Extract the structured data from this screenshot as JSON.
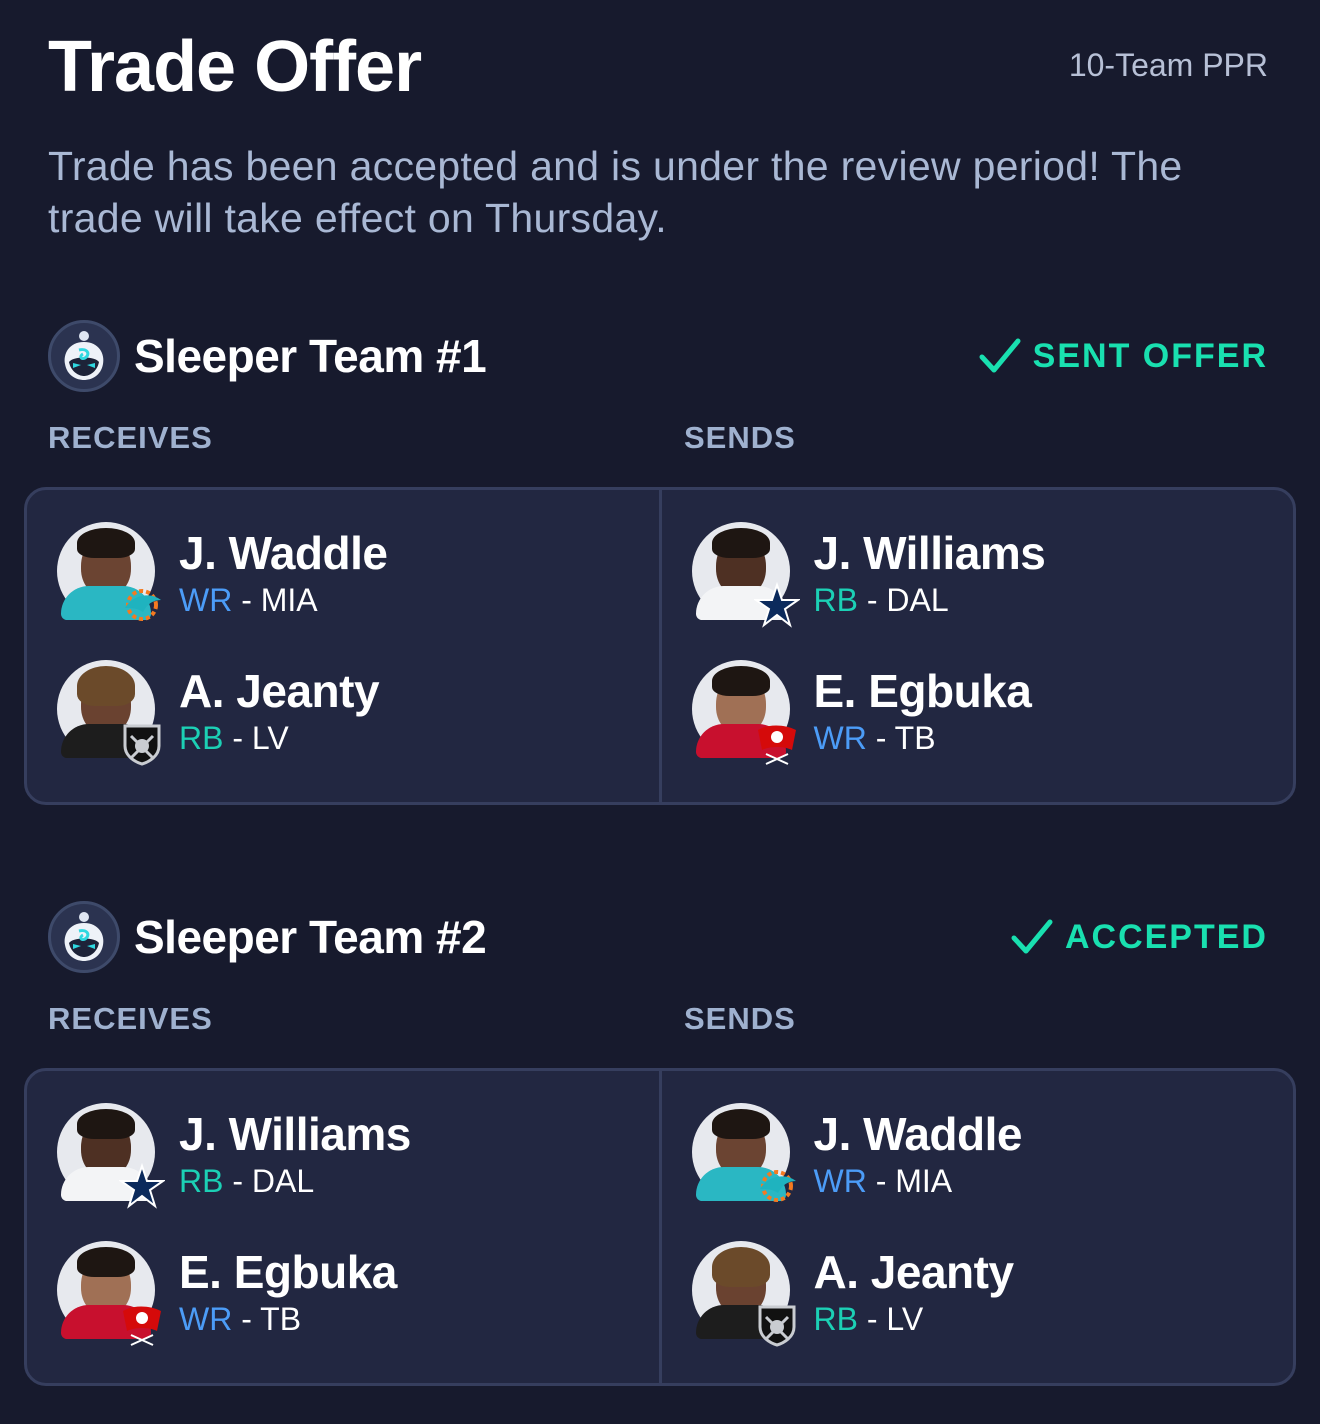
{
  "header": {
    "title": "Trade Offer",
    "league_type": "10-Team PPR",
    "status_message": "Trade has been accepted and is under the review period! The trade will take effect on Thursday."
  },
  "labels": {
    "receives": "RECEIVES",
    "sends": "SENDS"
  },
  "teams": [
    {
      "name": "Sleeper Team #1",
      "status": "SENT OFFER",
      "receives": [
        {
          "name": "J. Waddle",
          "position": "WR",
          "team": "MIA"
        },
        {
          "name": "A. Jeanty",
          "position": "RB",
          "team": "LV"
        }
      ],
      "sends": [
        {
          "name": "J. Williams",
          "position": "RB",
          "team": "DAL"
        },
        {
          "name": "E. Egbuka",
          "position": "WR",
          "team": "TB"
        }
      ]
    },
    {
      "name": "Sleeper Team #2",
      "status": "ACCEPTED",
      "receives": [
        {
          "name": "J. Williams",
          "position": "RB",
          "team": "DAL"
        },
        {
          "name": "E. Egbuka",
          "position": "WR",
          "team": "TB"
        }
      ],
      "sends": [
        {
          "name": "J. Waddle",
          "position": "WR",
          "team": "MIA"
        },
        {
          "name": "A. Jeanty",
          "position": "RB",
          "team": "LV"
        }
      ]
    }
  ],
  "separator": " - ",
  "colors": {
    "background": "#171a2d",
    "panel": "#222741",
    "accent_green": "#19e0b0",
    "wr_blue": "#4c9cf7",
    "rb_teal": "#1cd0b5"
  }
}
